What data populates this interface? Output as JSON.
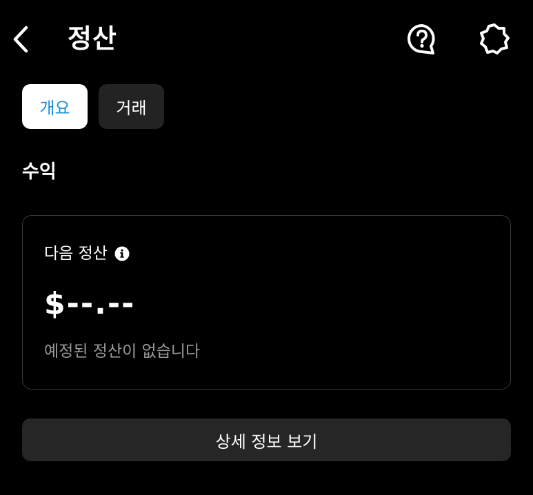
{
  "header": {
    "title": "정산",
    "back_icon": "chevron-left-icon",
    "help_icon": "help-bubble-icon",
    "settings_icon": "gear-icon"
  },
  "tabs": [
    {
      "label": "개요",
      "active": true
    },
    {
      "label": "거래",
      "active": false
    }
  ],
  "earnings": {
    "section_title": "수익",
    "card": {
      "label": "다음 정산",
      "info_icon": "info-icon",
      "amount": "$--.--",
      "status": "예정된 정산이 없습니다"
    }
  },
  "details_button": {
    "label": "상세 정보 보기"
  },
  "colors": {
    "background": "#000000",
    "active_tab_bg": "#ffffff",
    "active_tab_text": "#1a8fd6",
    "inactive_tab_bg": "#232323",
    "card_border": "#3a3a3a",
    "muted_text": "#9a9a9a",
    "button_bg": "#262626"
  }
}
